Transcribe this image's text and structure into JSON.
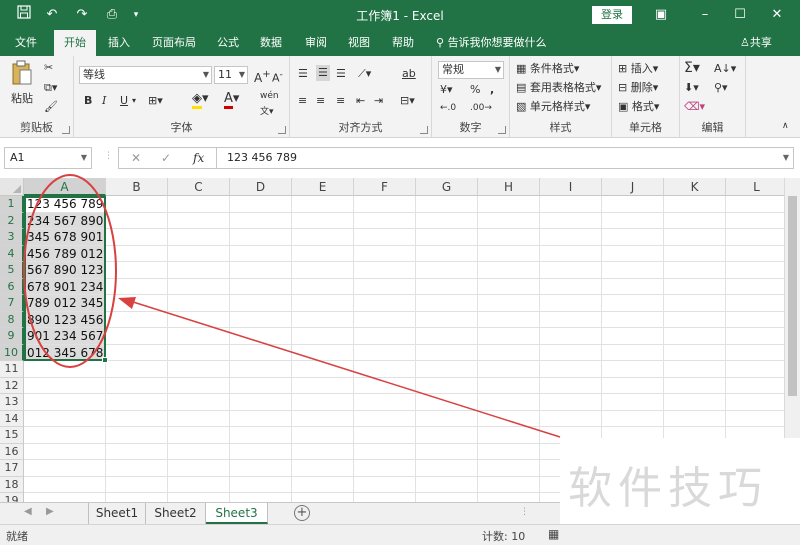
{
  "app": {
    "title": "工作簿1  -  Excel",
    "login_label": "登录",
    "icons": {
      "save": "save-icon",
      "undo": "undo-icon",
      "redo": "redo-icon",
      "print_preview": "print-preview-icon"
    }
  },
  "tabs": [
    {
      "label": "文件",
      "active": false
    },
    {
      "label": "开始",
      "active": true
    },
    {
      "label": "插入",
      "active": false
    },
    {
      "label": "页面布局",
      "active": false
    },
    {
      "label": "公式",
      "active": false
    },
    {
      "label": "数据",
      "active": false
    },
    {
      "label": "审阅",
      "active": false
    },
    {
      "label": "视图",
      "active": false
    },
    {
      "label": "帮助",
      "active": false
    }
  ],
  "tell_me": "告诉我你想要做什么",
  "share": "共享",
  "ribbon": {
    "clipboard": {
      "paste": "粘贴",
      "label": "剪贴板"
    },
    "font": {
      "name": "等线",
      "size": "11",
      "label": "字体",
      "bold": "B",
      "italic": "I",
      "underline": "U",
      "font_color_letter": "A",
      "phonetic": "wén"
    },
    "alignment": {
      "label": "对齐方式",
      "wrap": "ab"
    },
    "number": {
      "format": "常规",
      "label": "数字",
      "percent": "%",
      "comma": ","
    },
    "styles": {
      "conditional": "条件格式",
      "table": "套用表格格式",
      "cell_styles": "单元格样式",
      "label": "样式"
    },
    "cells": {
      "insert": "插入",
      "delete": "删除",
      "format": "格式",
      "label": "单元格"
    },
    "editing": {
      "label": "编辑"
    }
  },
  "formula_bar": {
    "name_box": "A1",
    "fx": "fx",
    "content": "123 456 789"
  },
  "columns": [
    "A",
    "B",
    "C",
    "D",
    "E",
    "F",
    "G",
    "H",
    "I",
    "J",
    "K",
    "L"
  ],
  "rows": [
    "1",
    "2",
    "3",
    "4",
    "5",
    "6",
    "7",
    "8",
    "9",
    "10",
    "11",
    "12",
    "13",
    "14",
    "15",
    "16",
    "17",
    "18",
    "19"
  ],
  "cells_A": [
    "123 456 789",
    "234 567 890",
    "345 678 901",
    "456 789 012",
    "567 890 123",
    "678 901 234",
    "789 012 345",
    "890 123 456",
    "901 234 567",
    "012 345 678"
  ],
  "sheets": [
    {
      "label": "Sheet1",
      "active": false
    },
    {
      "label": "Sheet2",
      "active": false
    },
    {
      "label": "Sheet3",
      "active": true
    }
  ],
  "status": {
    "ready": "就绪",
    "count": "计数: 10"
  },
  "watermark": "软件技巧",
  "colors": {
    "excel_green": "#217346",
    "annotation_red": "#d94040"
  }
}
